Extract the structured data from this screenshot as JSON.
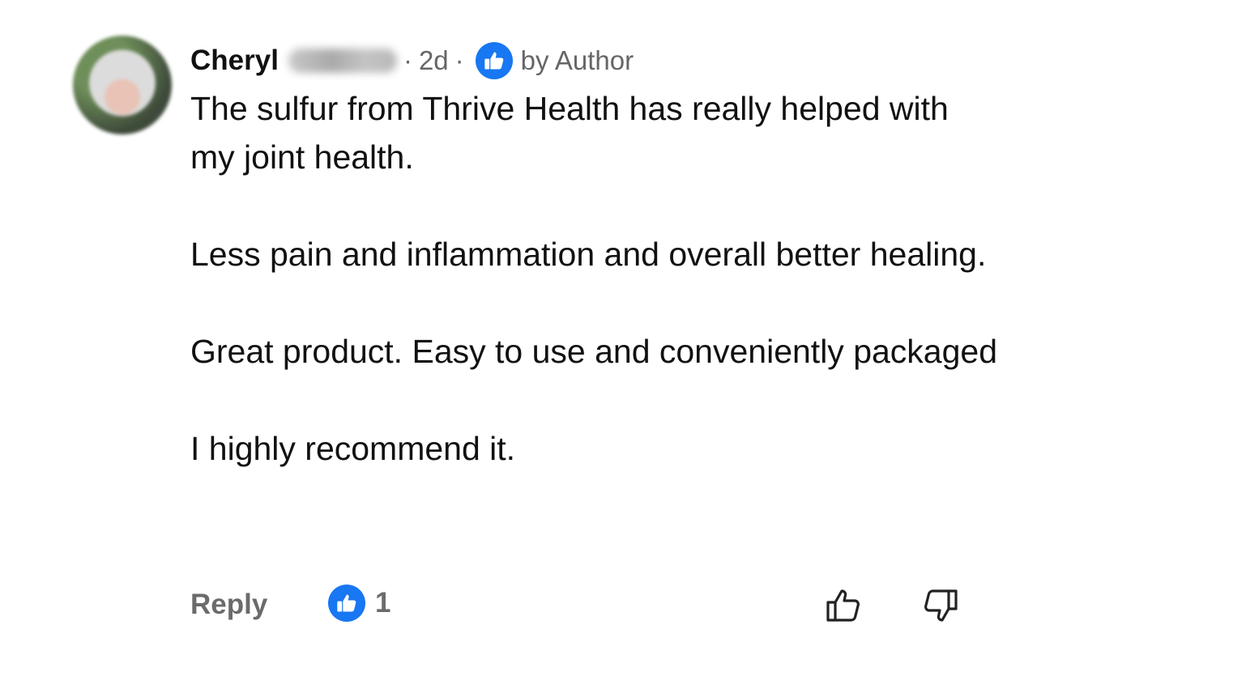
{
  "comment": {
    "author_first_name": "Cheryl",
    "separator": "·",
    "time_ago": "2d",
    "liked_by_label": "by Author",
    "paragraphs": [
      "The sulfur from Thrive Health has really helped with my joint health.",
      "Less pain and inflammation and overall better healing.",
      "Great product. Easy to use and conveniently packaged",
      "I highly recommend it."
    ],
    "reply_label": "Reply",
    "like_count": "1",
    "icons": {
      "liked_badge": "thumbs-up-filled-icon",
      "like_action": "thumbs-up-outline-icon",
      "dislike_action": "thumbs-down-outline-icon"
    },
    "colors": {
      "accent_blue": "#1877f2",
      "muted_text": "#6b6b6b"
    }
  }
}
